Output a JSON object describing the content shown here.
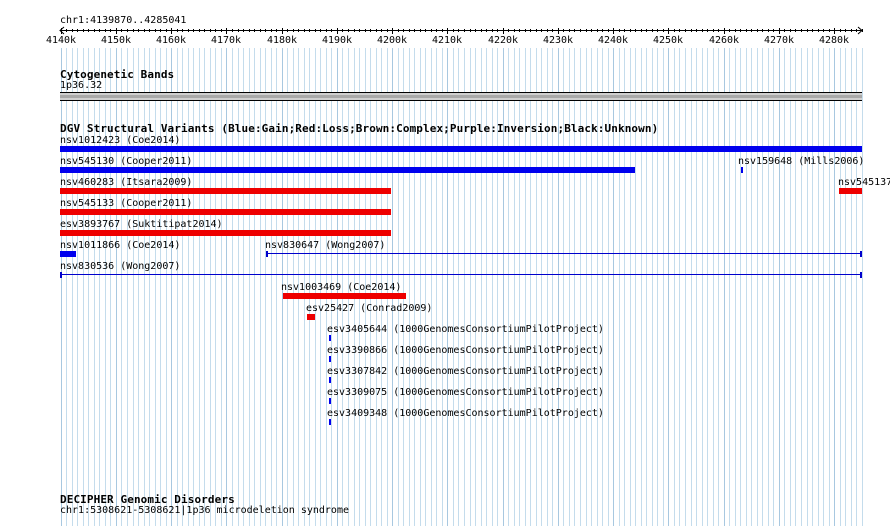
{
  "ruler": {
    "label": "chr1:4139870..4285041",
    "ticks": [
      "4140k",
      "4150k",
      "4160k",
      "4170k",
      "4180k",
      "4190k",
      "4200k",
      "4210k",
      "4220k",
      "4230k",
      "4240k",
      "4250k",
      "4260k",
      "4270k",
      "4280k"
    ]
  },
  "cytobands": {
    "title": "Cytogenetic Bands",
    "band": "1p36.32"
  },
  "dgv": {
    "title": "DGV Structural Variants (Blue:Gain;Red:Loss;Brown:Complex;Purple:Inversion;Black:Unknown)",
    "colors": {
      "gain": "#0000ee",
      "loss": "#ee0000",
      "unknown_line": "#0000cc"
    },
    "features": [
      {
        "label": "nsv1012423 (Coe2014)",
        "type": "gain",
        "start": 4139870,
        "end": 4285041
      },
      {
        "label": "nsv545130 (Cooper2011)",
        "type": "gain",
        "start": 4139870,
        "end": 4244000
      },
      {
        "label": "nsv159648 (Mills2006)",
        "type": "gain",
        "start": 4263050,
        "end": 4263200
      },
      {
        "label": "nsv545137",
        "type": "loss",
        "start": 4280800,
        "end": 4285041
      },
      {
        "label": "nsv460283 (Itsara2009)",
        "type": "loss",
        "start": 4139870,
        "end": 4199800
      },
      {
        "label": "nsv545133 (Cooper2011)",
        "type": "loss",
        "start": 4139870,
        "end": 4199800
      },
      {
        "label": "esv3893767 (Suktitipat2014)",
        "type": "loss",
        "start": 4139870,
        "end": 4199800
      },
      {
        "label": "nsv1011866 (Coe2014)",
        "type": "gain",
        "start": 4139870,
        "end": 4142700
      },
      {
        "label": "nsv830647 (Wong2007)",
        "type": "range",
        "start": 4177200,
        "end": 4285041
      },
      {
        "label": "nsv830536 (Wong2007)",
        "type": "range",
        "start": 4139870,
        "end": 4285041
      },
      {
        "label": "nsv1003469 (Coe2014)",
        "type": "loss",
        "start": 4180200,
        "end": 4202500
      },
      {
        "label": "esv25427 (Conrad2009)",
        "type": "loss",
        "start": 4184600,
        "end": 4186000
      },
      {
        "label": "esv3405644 (1000GenomesConsortiumPilotProject)",
        "type": "tiny",
        "start": 4188650,
        "end": 4188700
      },
      {
        "label": "esv3390866 (1000GenomesConsortiumPilotProject)",
        "type": "tiny",
        "start": 4188650,
        "end": 4188700
      },
      {
        "label": "esv3307842 (1000GenomesConsortiumPilotProject)",
        "type": "tiny",
        "start": 4188650,
        "end": 4188700
      },
      {
        "label": "esv3309075 (1000GenomesConsortiumPilotProject)",
        "type": "tiny",
        "start": 4188650,
        "end": 4188700
      },
      {
        "label": "esv3409348 (1000GenomesConsortiumPilotProject)",
        "type": "tiny",
        "start": 4188650,
        "end": 4188700
      }
    ]
  },
  "decipher": {
    "title": "DECIPHER Genomic Disorders",
    "entry": "chr1:5308621-5308621|1p36 microdeletion syndrome"
  }
}
